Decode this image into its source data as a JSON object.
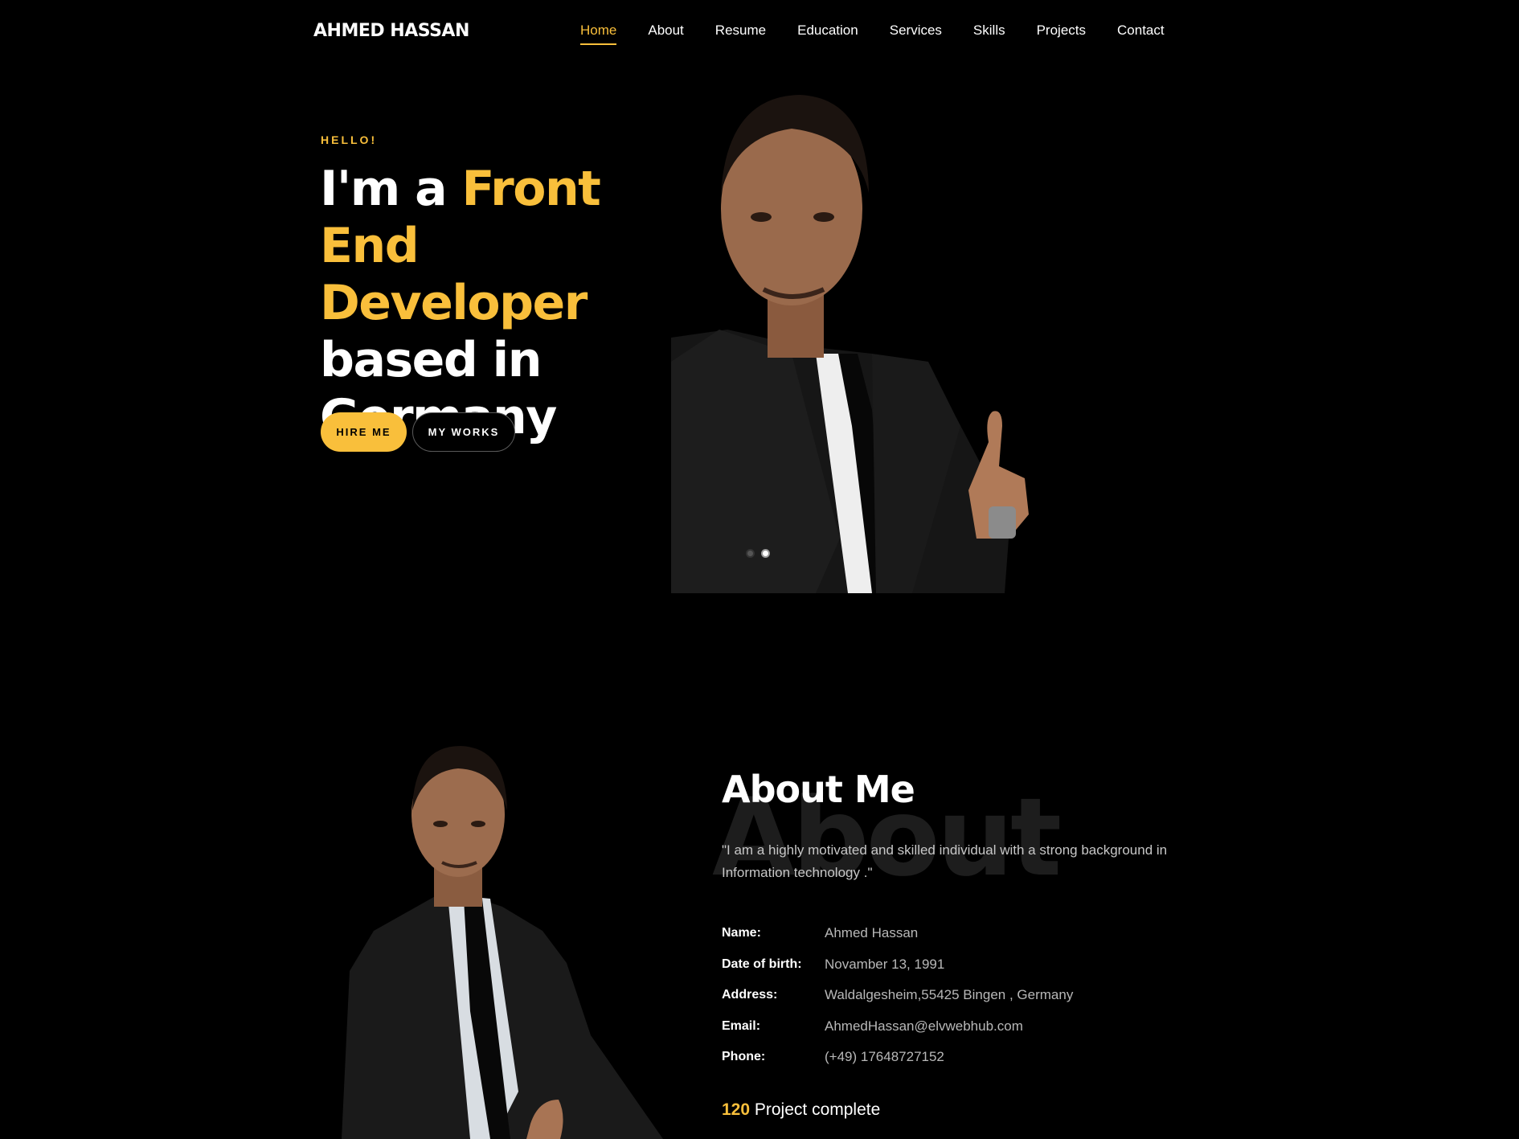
{
  "brand": "AHMED HASSAN",
  "nav": [
    "Home",
    "About",
    "Resume",
    "Education",
    "Services",
    "Skills",
    "Projects",
    "Contact"
  ],
  "hero": {
    "hello": "HELLO!",
    "line1_pre": "I'm a ",
    "line1_hl": "Front End",
    "line2_hl": "Developer",
    "line3": "based in",
    "line4": "Germany",
    "hire_btn": "HIRE ME",
    "works_btn": "MY WORKS"
  },
  "about": {
    "bg_text": "About",
    "title": "About Me",
    "quote": "\"I am a highly motivated and skilled individual with a strong background in Information technology .\"",
    "info": [
      {
        "k": "Name:",
        "v": "Ahmed Hassan"
      },
      {
        "k": "Date of birth:",
        "v": "Novamber 13, 1991"
      },
      {
        "k": "Address:",
        "v": "Waldalgesheim,55425 Bingen , Germany"
      },
      {
        "k": "Email:",
        "v": "AhmedHassan@elvwebhub.com"
      },
      {
        "k": "Phone:",
        "v": "(+49) 17648727152"
      }
    ],
    "projects_count": "120",
    "projects_label": " Project complete"
  },
  "colors": {
    "accent": "#f9bf3b",
    "background": "#000000"
  }
}
